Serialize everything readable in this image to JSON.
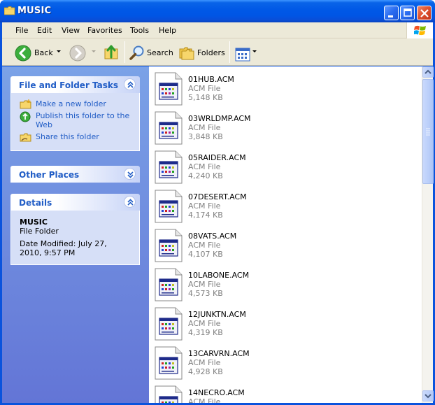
{
  "window": {
    "title": "MUSIC",
    "title_icon": "folder-icon"
  },
  "menu": {
    "items": [
      "File",
      "Edit",
      "View",
      "Favorites",
      "Tools",
      "Help"
    ]
  },
  "toolbar": {
    "back_label": "Back",
    "search_label": "Search",
    "folders_label": "Folders"
  },
  "tasks": {
    "title": "File and Folder Tasks",
    "items": [
      {
        "label": "Make a new folder",
        "icon": "new-folder-icon"
      },
      {
        "label": "Publish this folder to the Web",
        "icon": "publish-web-icon"
      },
      {
        "label": "Share this folder",
        "icon": "share-folder-icon"
      }
    ]
  },
  "other_places": {
    "title": "Other Places"
  },
  "details": {
    "title": "Details",
    "name": "MUSIC",
    "type": "File Folder",
    "modified": "Date Modified: July 27, 2010, 9:57 PM"
  },
  "files": [
    {
      "name": "01HUB.ACM",
      "type": "ACM File",
      "size": "5,148 KB"
    },
    {
      "name": "03WRLDMP.ACM",
      "type": "ACM File",
      "size": "3,848 KB"
    },
    {
      "name": "05RAIDER.ACM",
      "type": "ACM File",
      "size": "4,240 KB"
    },
    {
      "name": "07DESERT.ACM",
      "type": "ACM File",
      "size": "4,174 KB"
    },
    {
      "name": "08VATS.ACM",
      "type": "ACM File",
      "size": "4,107 KB"
    },
    {
      "name": "10LABONE.ACM",
      "type": "ACM File",
      "size": "4,573 KB"
    },
    {
      "name": "12JUNKTN.ACM",
      "type": "ACM File",
      "size": "4,319 KB"
    },
    {
      "name": "13CARVRN.ACM",
      "type": "ACM File",
      "size": "4,928 KB"
    },
    {
      "name": "14NECRO.ACM",
      "type": "ACM File",
      "size": ""
    }
  ],
  "colors": {
    "title_bar": "#0055e5",
    "task_pane": "#6f8edd",
    "link": "#215dc6",
    "secondary_text": "#808080"
  }
}
